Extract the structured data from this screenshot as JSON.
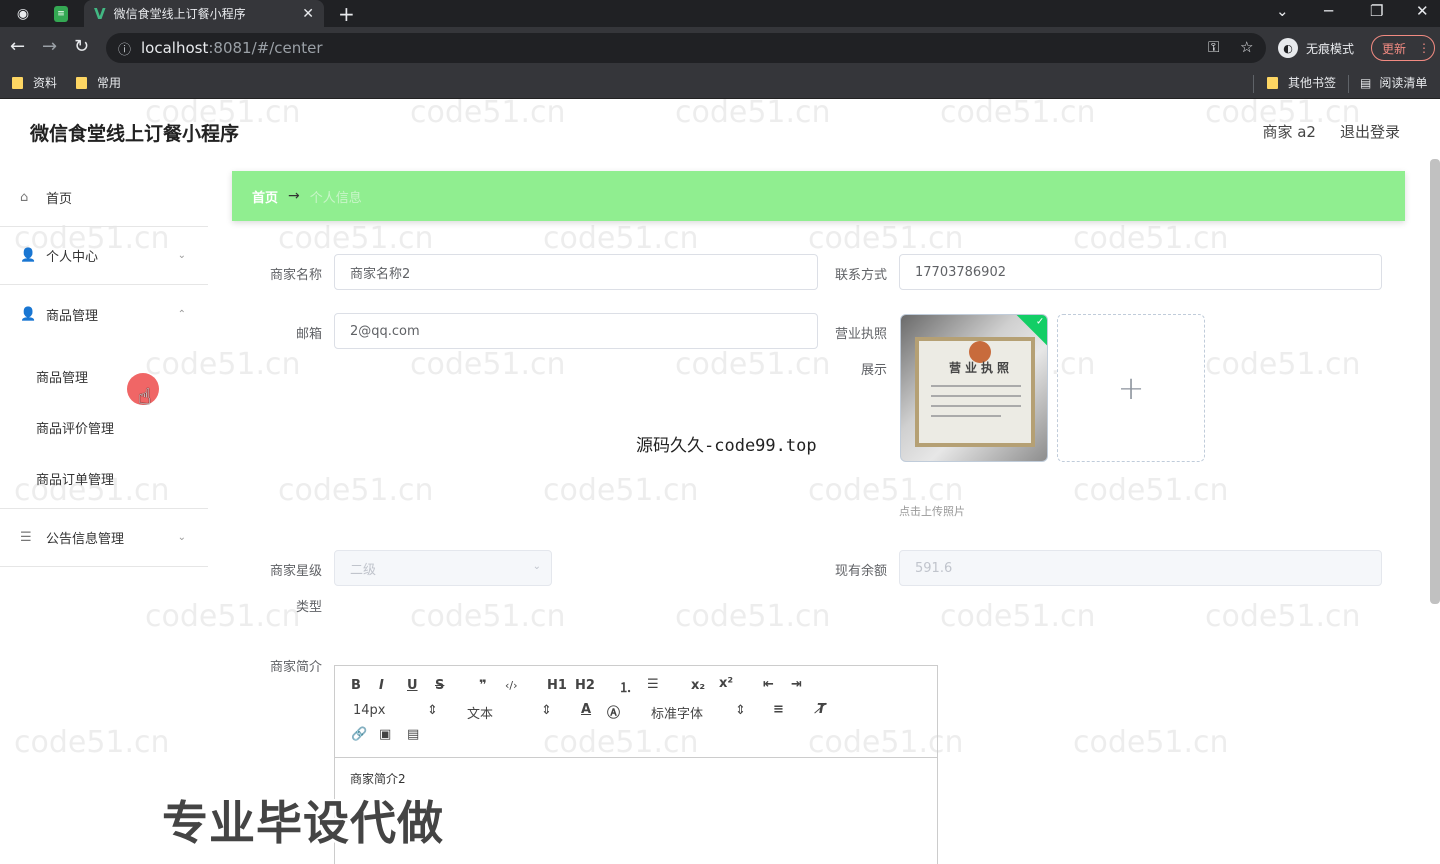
{
  "browser": {
    "tab_title": "微信食堂线上订餐小程序",
    "url_host": "localhost",
    "url_path": ":8081/#/center",
    "incognito_label": "无痕模式",
    "update_label": "更新",
    "bookmarks": [
      "资料",
      "常用"
    ],
    "bookmarks_right": [
      "其他书签",
      "阅读清单"
    ]
  },
  "header": {
    "app_title": "微信食堂线上订餐小程序",
    "user_label": "商家 a2",
    "logout_label": "退出登录"
  },
  "sidebar": {
    "items": [
      {
        "label": "首页",
        "icon": "home-icon"
      },
      {
        "label": "个人中心",
        "icon": "user-icon"
      },
      {
        "label": "商品管理",
        "icon": "user-icon"
      },
      {
        "label": "公告信息管理",
        "icon": "list-icon"
      }
    ],
    "sub_items": [
      "商品管理",
      "商品评价管理",
      "商品订单管理"
    ]
  },
  "breadcrumb": {
    "home": "首页",
    "separator": "→",
    "current": "个人信息"
  },
  "form": {
    "name_label": "商家名称",
    "name_value": "商家名称2",
    "phone_label": "联系方式",
    "phone_value": "17703786902",
    "email_label": "邮箱",
    "email_value": "2@qq.com",
    "license_label_1": "营业执照",
    "license_label_2": "展示",
    "license_doc_title": "营业执照",
    "upload_plus": "+",
    "upload_tip": "点击上传照片",
    "level_label_1": "商家星级",
    "level_label_2": "类型",
    "level_value": "二级",
    "balance_label": "现有余额",
    "balance_value": "591.6",
    "intro_label": "商家简介",
    "intro_value": "商家简介2"
  },
  "editor": {
    "font_size": "14px",
    "paragraph": "文本",
    "font_family": "标准字体",
    "buttons": [
      "B",
      "I",
      "U",
      "S",
      "❞",
      "‹/›",
      "H1",
      "H2"
    ]
  },
  "watermarks": {
    "repeat": "code51.cn",
    "center": "源码久久-code99.top",
    "bottom": "专业毕设代做"
  },
  "colors": {
    "breadcrumb_bg": "#90ee90",
    "success_badge": "#13ce66"
  }
}
